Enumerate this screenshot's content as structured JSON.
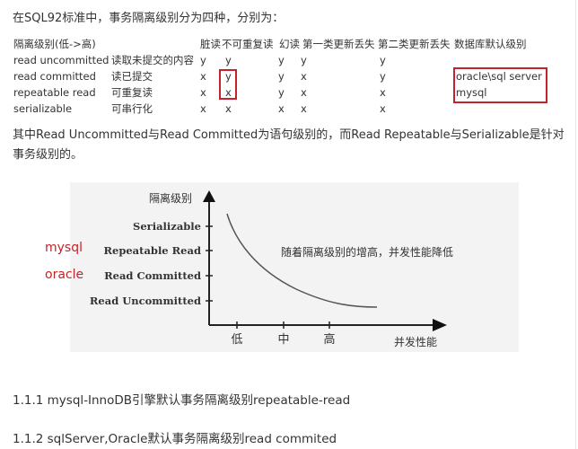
{
  "intro": "在SQL92标准中，事务隔离级别分为四种，分别为：",
  "table": {
    "headers": [
      "隔离级别(低->高)",
      "",
      "脏读",
      "不可重复读",
      "幻读",
      "第一类更新丢失",
      "第二类更新丢失",
      "数据库默认级别"
    ],
    "rows": [
      [
        "read uncommitted",
        "读取未提交的内容",
        "y",
        "y",
        "y",
        "y",
        "y",
        ""
      ],
      [
        "read committed",
        "读已提交",
        "x",
        "y",
        "y",
        "x",
        "y",
        "oracle\\sql server"
      ],
      [
        "repeatable read",
        "可重复读",
        "x",
        "x",
        "y",
        "x",
        "x",
        "mysql"
      ],
      [
        "serializable",
        "可串行化",
        "x",
        "x",
        "x",
        "x",
        "x",
        ""
      ]
    ],
    "highlight_color": "#c4232b"
  },
  "paragraph": "其中Read Uncommitted与Read Committed为语句级别的，而Read Repeatable与Serializable是针对事务级别的。",
  "chart_data": {
    "type": "line",
    "title": "",
    "ylabel": "隔离级别",
    "xlabel": "并发性能",
    "y_ticks": [
      "Read Uncommitted",
      "Read Committed",
      "Repeatable Read",
      "Serializable"
    ],
    "x_ticks": [
      "低",
      "中",
      "高"
    ],
    "annotation": "随着隔离级别的增高，并发性能降低",
    "series": [
      {
        "name": "curve",
        "description": "decreasing convex curve: isolation level falls as concurrency rises"
      }
    ],
    "side_labels": [
      {
        "text": "mysql",
        "level": "Repeatable Read",
        "color": "#c4232b"
      },
      {
        "text": "oracle",
        "level": "Read Committed",
        "color": "#c4232b"
      }
    ]
  },
  "sections": [
    "1.1.1 mysql-InnoDB引擎默认事务隔离级别repeatable-read",
    "1.1.2 sqlServer,Oracle默认事务隔离级别read commited"
  ]
}
